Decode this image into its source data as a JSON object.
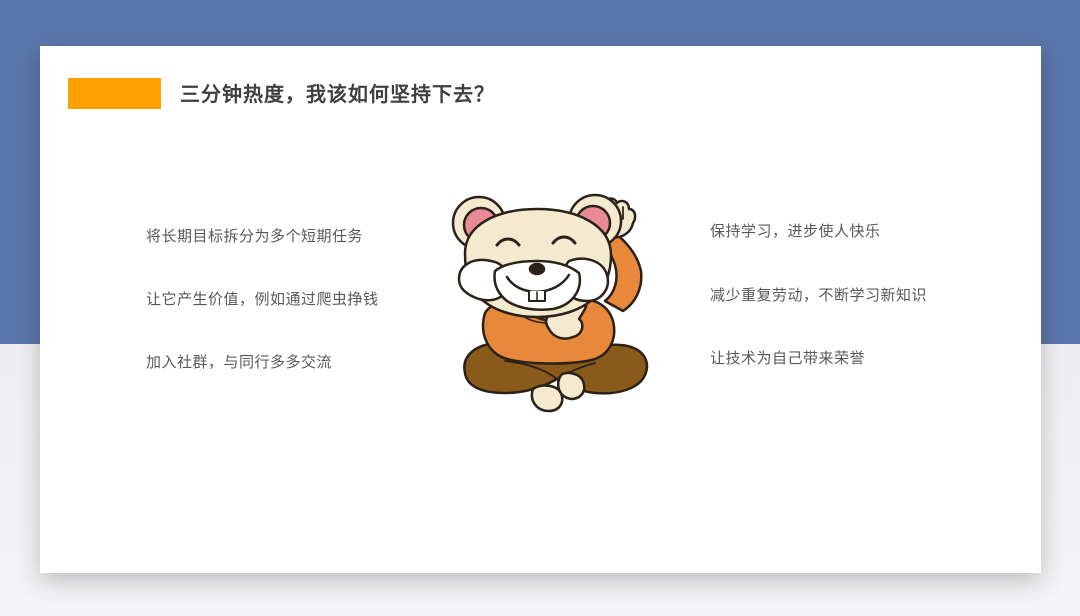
{
  "slide": {
    "title": "三分钟热度，我该如何坚持下去？",
    "left_items": [
      "将长期目标拆分为多个短期任务",
      "让它产生价值，例如通过爬虫挣钱",
      "加入社群，与同行多多交流"
    ],
    "right_items": [
      "保持学习，进步使人快乐",
      "减少重复劳动，不断学习新知识",
      "让技术为自己带来荣誉"
    ],
    "mascot_icon": "mouse-cartoon-icon"
  },
  "colors": {
    "accent": "#ffa000",
    "header_band": "#5b76ab",
    "card": "#ffffff",
    "text": "#595959",
    "title": "#3f3f3f"
  }
}
